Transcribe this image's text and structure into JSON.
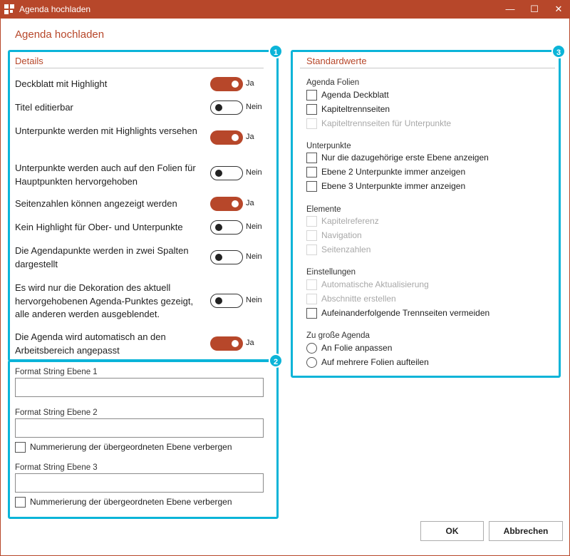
{
  "window": {
    "title": "Agenda hochladen",
    "minimize_glyph": "—",
    "maximize_glyph": "☐",
    "close_glyph": "✕"
  },
  "dialog": {
    "heading": "Agenda hochladen"
  },
  "callouts": {
    "one": "1",
    "two": "2",
    "three": "3"
  },
  "details": {
    "title": "Details",
    "rows": [
      {
        "label": "Deckblatt mit Highlight",
        "on": true,
        "state": "Ja"
      },
      {
        "label": "Titel editierbar",
        "on": false,
        "state": "Nein"
      },
      {
        "label": "Unterpunkte werden mit Highlights versehen",
        "on": true,
        "state": "Ja"
      },
      {
        "label": "Unterpunkte werden auch auf den Folien für Hauptpunkten hervorgehoben",
        "on": false,
        "state": "Nein"
      },
      {
        "label": "Seitenzahlen können angezeigt werden",
        "on": true,
        "state": "Ja"
      },
      {
        "label": "Kein Highlight für Ober- und Unterpunkte",
        "on": false,
        "state": "Nein"
      },
      {
        "label": "Die Agendapunkte werden in zwei Spalten dargestellt",
        "on": false,
        "state": "Nein"
      },
      {
        "label": "Es wird nur die Dekoration des aktuell hervorgehobenen Agenda-Punktes gezeigt, alle anderen werden ausgeblendet.",
        "on": false,
        "state": "Nein"
      },
      {
        "label": "Die Agenda wird automatisch an den Arbeitsbereich angepasst",
        "on": true,
        "state": "Ja"
      }
    ]
  },
  "format": {
    "level1": {
      "label": "Format String Ebene 1",
      "value": ""
    },
    "level2": {
      "label": "Format String Ebene 2",
      "value": ""
    },
    "level2_hide": "Nummerierung der übergeordneten Ebene verbergen",
    "level3": {
      "label": "Format String Ebene 3",
      "value": ""
    },
    "level3_hide": "Nummerierung der übergeordneten Ebene verbergen"
  },
  "defaults": {
    "title": "Standardwerte",
    "agenda_slides": {
      "label": "Agenda Folien",
      "items": [
        "Agenda Deckblatt",
        "Kapiteltrennseiten",
        "Kapiteltrennseiten für Unterpunkte"
      ]
    },
    "subpoints": {
      "label": "Unterpunkte",
      "items": [
        "Nur die dazugehörige erste Ebene anzeigen",
        "Ebene 2 Unterpunkte immer anzeigen",
        "Ebene 3 Unterpunkte immer anzeigen"
      ]
    },
    "elements": {
      "label": "Elemente",
      "items": [
        "Kapitelreferenz",
        "Navigation",
        "Seitenzahlen"
      ]
    },
    "settings": {
      "label": "Einstellungen",
      "items": [
        "Automatische Aktualisierung",
        "Abschnitte erstellen",
        "Aufeinanderfolgende Trennseiten vermeiden"
      ]
    },
    "oversize": {
      "label": "Zu große Agenda",
      "options": [
        "An Folie anpassen",
        "Auf mehrere Folien aufteilen"
      ]
    }
  },
  "buttons": {
    "ok": "OK",
    "cancel": "Abbrechen"
  },
  "colors": {
    "accent": "#b7472a",
    "callout": "#0bb4d8"
  }
}
